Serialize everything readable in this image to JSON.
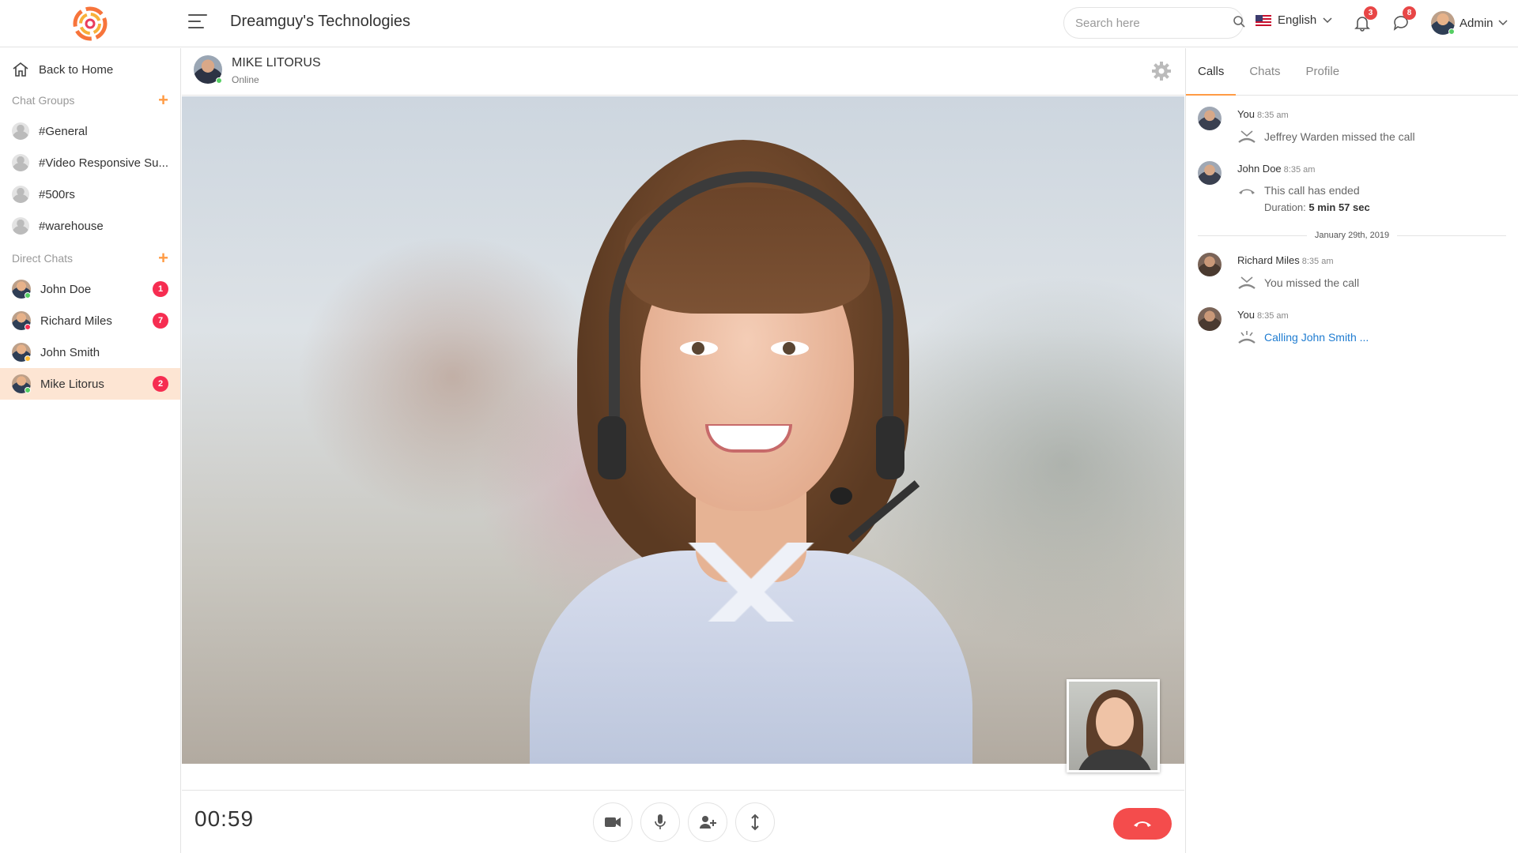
{
  "header": {
    "title": "Dreamguy's Technologies",
    "search_placeholder": "Search here",
    "language": "English",
    "notifications_count": "3",
    "messages_count": "8",
    "user": "Admin"
  },
  "sidebar": {
    "back_label": "Back to Home",
    "groups_title": "Chat Groups",
    "groups": [
      {
        "label": "#General"
      },
      {
        "label": "#Video Responsive Su..."
      },
      {
        "label": "#500rs"
      },
      {
        "label": "#warehouse"
      }
    ],
    "direct_title": "Direct Chats",
    "direct": [
      {
        "label": "John Doe",
        "badge": "1",
        "status": "online"
      },
      {
        "label": "Richard Miles",
        "badge": "7",
        "status": "offline"
      },
      {
        "label": "John Smith",
        "badge": "",
        "status": "away"
      },
      {
        "label": "Mike Litorus",
        "badge": "2",
        "status": "online",
        "active": true
      }
    ]
  },
  "call": {
    "name": "MIKE LITORUS",
    "status": "Online",
    "timer": "00:59"
  },
  "right_panel": {
    "tabs": [
      "Calls",
      "Chats",
      "Profile"
    ],
    "active_tab": "Calls",
    "log": [
      {
        "name": "You",
        "time": "8:35 am",
        "text": "Jeffrey Warden missed the call"
      },
      {
        "name": "John Doe",
        "time": "8:35 am",
        "text": "This call has ended",
        "duration_label": "Duration:",
        "duration_value": "5 min 57 sec"
      },
      {
        "date": "January 29th, 2019"
      },
      {
        "name": "Richard Miles",
        "time": "8:35 am",
        "text": "You missed the call"
      },
      {
        "name": "You",
        "time": "8:35 am",
        "text": "Calling John Smith ..."
      }
    ]
  },
  "colors": {
    "accent": "#ff9b44",
    "badge": "#f62d51",
    "end_call": "#f44c4c",
    "link": "#1f7cd1",
    "online": "#55ce63"
  }
}
